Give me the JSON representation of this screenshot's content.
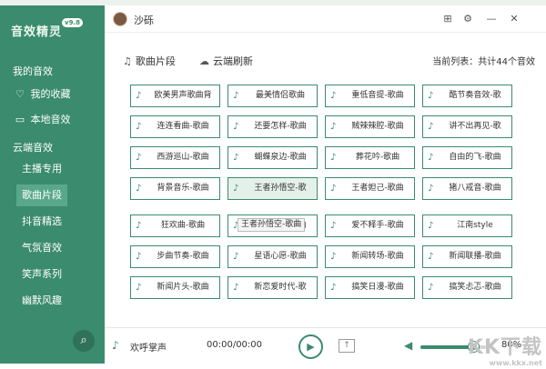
{
  "app": {
    "logo_text": "音效精灵",
    "version": "v9.8",
    "user": "沙砾"
  },
  "sidebar": {
    "my_sounds": "我的音效",
    "favorites": "我的收藏",
    "local": "本地音效",
    "cloud_sounds": "云端音效",
    "categories": [
      {
        "label": "主播专用",
        "active": false
      },
      {
        "label": "歌曲片段",
        "active": true
      },
      {
        "label": "抖音精选",
        "active": false
      },
      {
        "label": "气氛音效",
        "active": false
      },
      {
        "label": "笑声系列",
        "active": false
      },
      {
        "label": "幽默风趣",
        "active": false
      }
    ],
    "search_icon": "search-icon"
  },
  "toolbar": {
    "clip_label": "歌曲片段",
    "refresh_label": "云端刷新",
    "count_text": "当前列表：共计44个音效"
  },
  "songs": [
    "欧美男声歌曲背",
    "最美情侣歌曲",
    "重低音提-歌曲",
    "酷节奏音效-歌",
    "连连看曲-歌曲",
    "还要怎样-歌曲",
    "贼辣辣腔-歌曲",
    "讲不出再见-歌",
    "西游巡山-歌曲",
    "蝴蝶泉边-歌曲",
    "葬花吟-歌曲",
    "自由的飞-歌曲",
    "背景音乐-歌曲",
    "王者孙悟空-歌",
    "王者妲己-歌曲",
    "猪八戒音-歌曲",
    "狂欢曲-歌曲",
    "爱情很美-歌曲",
    "爱不释手-歌曲",
    "江南style",
    "步曲节奏-歌曲",
    "星语心愿-歌曲",
    "新闻转场-歌曲",
    "新闻联播-歌曲",
    "新闻片头-歌曲",
    "新恋爱时代-歌",
    "搞笑日漫-歌曲",
    "搞笑忐忑-歌曲"
  ],
  "tooltip": "王者孙悟空-歌曲",
  "player": {
    "track": "欢呼掌声",
    "time": "00:00/00:00",
    "volume_percent": 80,
    "volume_label": "80%"
  },
  "watermark": {
    "big": "KK下载",
    "small": "www.kkx.net"
  },
  "colors": {
    "accent": "#3b8b6e",
    "sidebar_active": "#5aa88b"
  },
  "icons": {
    "song": "music-note-icon",
    "clip": "music-list-icon",
    "refresh": "cloud-refresh-icon",
    "play": "play-icon",
    "next": "next-icon",
    "volume": "volume-icon"
  }
}
